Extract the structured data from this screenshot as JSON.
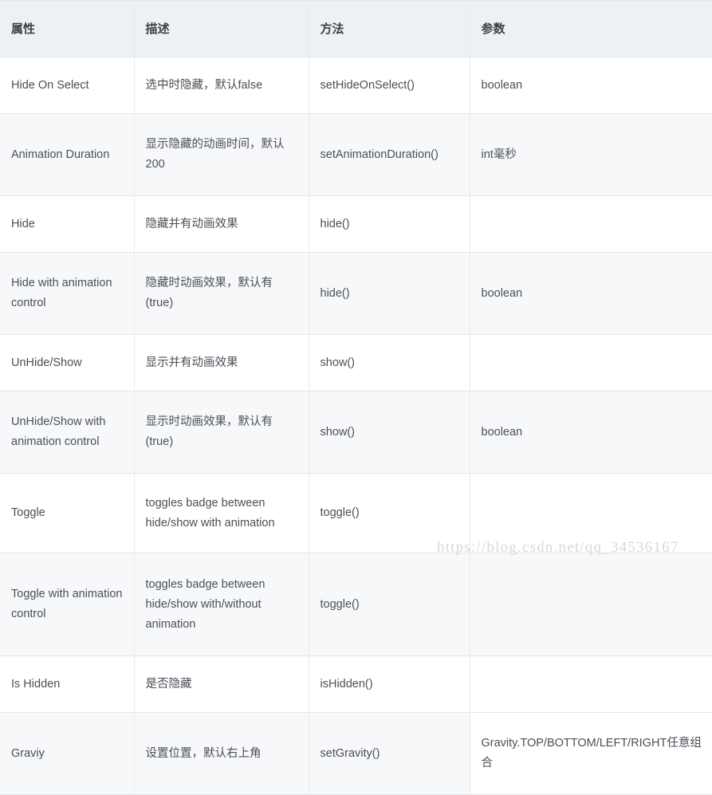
{
  "table": {
    "headers": [
      "属性",
      "描述",
      "方法",
      "参数"
    ],
    "rows": [
      {
        "attribute": "Hide On Select",
        "description": "选中时隐藏，默认false",
        "method": "setHideOnSelect()",
        "parameter": "boolean"
      },
      {
        "attribute": "Animation Duration",
        "description": "显示隐藏的动画时间，默认200",
        "method": "setAnimationDuration()",
        "parameter": "int毫秒"
      },
      {
        "attribute": "Hide",
        "description": "隐藏并有动画效果",
        "method": "hide()",
        "parameter": ""
      },
      {
        "attribute": "Hide with animation control",
        "description": "隐藏时动画效果，默认有(true)",
        "method": "hide()",
        "parameter": "boolean"
      },
      {
        "attribute": "UnHide/Show",
        "description": "显示并有动画效果",
        "method": "show()",
        "parameter": ""
      },
      {
        "attribute": "UnHide/Show with animation control",
        "description": "显示时动画效果，默认有(true)",
        "method": "show()",
        "parameter": "boolean"
      },
      {
        "attribute": "Toggle",
        "description": "toggles badge between hide/show with animation",
        "method": "toggle()",
        "parameter": ""
      },
      {
        "attribute": "Toggle with animation control",
        "description": "toggles badge between hide/show with/without animation",
        "method": "toggle()",
        "parameter": ""
      },
      {
        "attribute": "Is Hidden",
        "description": "是否隐藏",
        "method": "isHidden()",
        "parameter": ""
      },
      {
        "attribute": "Graviy",
        "description": "设置位置，默认右上角",
        "method": "setGravity()",
        "parameter": "Gravity.TOP/BOTTOM/LEFT/RIGHT任意组合"
      }
    ]
  },
  "watermark": {
    "text": "https://blog.csdn.net/qq_34536167"
  },
  "colors": {
    "header_background": "#eef1f4",
    "row_odd_background": "#ffffff",
    "row_even_background": "#f7f8fa",
    "border": "#e3e6ea",
    "text": "#4a4f57",
    "watermark": "#d8d8dc"
  }
}
